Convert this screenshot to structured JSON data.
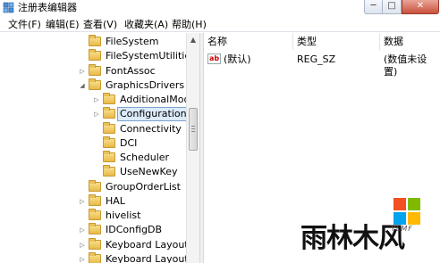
{
  "window": {
    "title": "注册表编辑器",
    "controls": {
      "minimize": "─",
      "maximize": "□",
      "close": "✕"
    }
  },
  "menubar": {
    "items": [
      "文件(F)",
      "编辑(E)",
      "查看(V)",
      "收藏夹(A)",
      "帮助(H)"
    ]
  },
  "tree": {
    "nodes": [
      {
        "label": "FileSystem",
        "level": 0,
        "expander": "",
        "selected": false
      },
      {
        "label": "FileSystemUtilities",
        "level": 0,
        "expander": "",
        "selected": false
      },
      {
        "label": "FontAssoc",
        "level": 0,
        "expander": "▷",
        "selected": false
      },
      {
        "label": "GraphicsDrivers",
        "level": 0,
        "expander": "◢",
        "selected": false
      },
      {
        "label": "AdditionalMode",
        "level": 1,
        "expander": "▷",
        "selected": false
      },
      {
        "label": "Configuration",
        "level": 1,
        "expander": "▷",
        "selected": true
      },
      {
        "label": "Connectivity",
        "level": 1,
        "expander": "",
        "selected": false
      },
      {
        "label": "DCI",
        "level": 1,
        "expander": "",
        "selected": false
      },
      {
        "label": "Scheduler",
        "level": 1,
        "expander": "",
        "selected": false
      },
      {
        "label": "UseNewKey",
        "level": 1,
        "expander": "",
        "selected": false
      },
      {
        "label": "GroupOrderList",
        "level": 0,
        "expander": "",
        "selected": false
      },
      {
        "label": "HAL",
        "level": 0,
        "expander": "▷",
        "selected": false
      },
      {
        "label": "hivelist",
        "level": 0,
        "expander": "",
        "selected": false
      },
      {
        "label": "IDConfigDB",
        "level": 0,
        "expander": "▷",
        "selected": false
      },
      {
        "label": "Keyboard Layout",
        "level": 0,
        "expander": "▷",
        "selected": false
      },
      {
        "label": "Keyboard Layouts",
        "level": 0,
        "expander": "▷",
        "selected": false
      }
    ]
  },
  "list": {
    "columns": [
      "名称",
      "类型",
      "数据"
    ],
    "rows": [
      {
        "icon": "ab",
        "name": "(默认)",
        "type": "REG_SZ",
        "data": "(数值未设置)"
      }
    ]
  },
  "watermark": {
    "brand": "雨林木风",
    "sub": "YLMF",
    "colors": [
      "#f25022",
      "#7fba00",
      "#00a4ef",
      "#ffb900"
    ]
  }
}
